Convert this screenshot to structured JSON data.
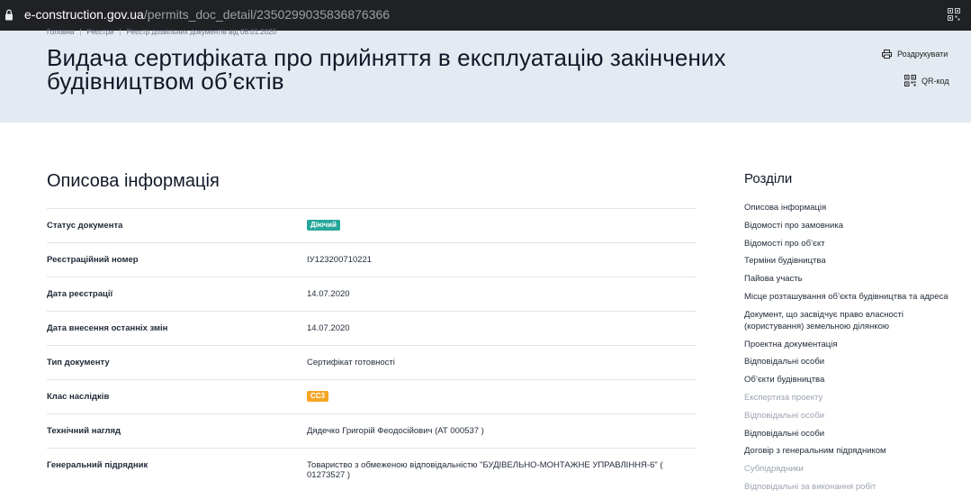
{
  "browser": {
    "url_host": "e-construction.gov.ua",
    "url_path": "/permits_doc_detail/2350299035836876366"
  },
  "breadcrumb": {
    "home": "Головна",
    "registries": "Реєстри",
    "current": "Реєстр дозвільних документів від 06.01.2020"
  },
  "page": {
    "title": "Видача сертифіката про прийняття в експлуатацію закінчених будівництвом об’єктів",
    "print_label": "Роздрукувати",
    "qr_label": "QR-код"
  },
  "details": {
    "heading": "Описова інформація",
    "rows": [
      {
        "label": "Статус документа",
        "value": "Діючий",
        "badge": "green"
      },
      {
        "label": "Реєстраційний номер",
        "value": "ІУ123200710221"
      },
      {
        "label": "Дата реєстрації",
        "value": "14.07.2020"
      },
      {
        "label": "Дата внесення останніх змін",
        "value": "14.07.2020"
      },
      {
        "label": "Тип документу",
        "value": "Сертифікат готовності"
      },
      {
        "label": "Клас наслідків",
        "value": "СС3",
        "badge": "orange"
      },
      {
        "label": "Технічний нагляд",
        "value": "Дядечко Григорій Феодосійович (АТ 000537 )"
      },
      {
        "label": "Генеральний підрядник",
        "value": "Товариство з обмеженою відповідальністю \"БУДІВЕЛЬНО-МОНТАЖНЕ УПРАВЛІННЯ-6\" ( 01273527 )"
      }
    ]
  },
  "toc": {
    "heading": "Розділи",
    "items": [
      {
        "label": "Описова інформація",
        "muted": false
      },
      {
        "label": "Відомості про замовника",
        "muted": false
      },
      {
        "label": "Відомості про об’єкт",
        "muted": false
      },
      {
        "label": "Терміни будівництва",
        "muted": false
      },
      {
        "label": "Пайова участь",
        "muted": false
      },
      {
        "label": "Місце розташування об’єкта будівництва та адреса",
        "muted": false
      },
      {
        "label": "Документ, що засвідчує право власності (користування) земельною ділянкою",
        "muted": false
      },
      {
        "label": "Проектна документація",
        "muted": false
      },
      {
        "label": "Відповідальні особи",
        "muted": false
      },
      {
        "label": "Об’єкти будівництва",
        "muted": false
      },
      {
        "label": "Експертиза проекту",
        "muted": true
      },
      {
        "label": "Відповідальні особи",
        "muted": true
      },
      {
        "label": "Відповідальні особи",
        "muted": false
      },
      {
        "label": "Договір з генеральним підрядником",
        "muted": false
      },
      {
        "label": "Субпідрядники",
        "muted": true
      },
      {
        "label": "Відповідальні за виконання робіт",
        "muted": true
      }
    ]
  },
  "colors": {
    "status_active": "#26a69a",
    "consequence_class": "#f5a623",
    "hero_bg": "#e4eaf1"
  }
}
